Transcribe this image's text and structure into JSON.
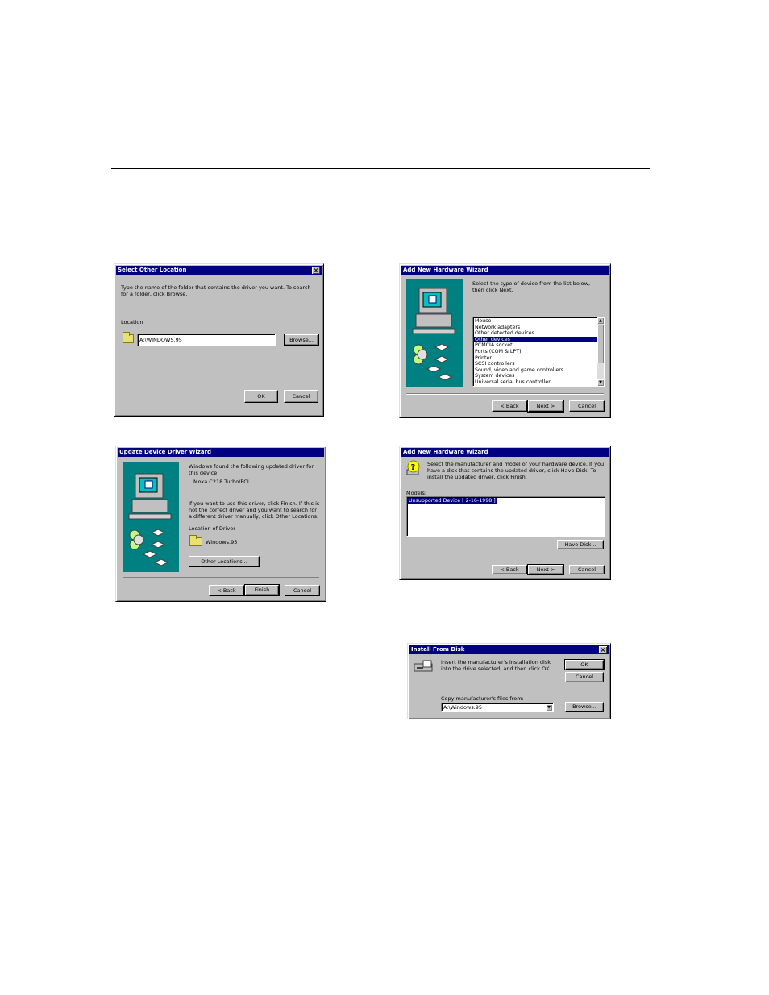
{
  "dialogs": {
    "select_location": {
      "title": "Select Other Location",
      "instruction": "Type the name of the folder that contains the driver you want. To search for a folder, click Browse.",
      "location_label": "Location",
      "location_value": "A:\\WINDOWS.95",
      "browse_label": "Browse...",
      "ok_label": "OK",
      "cancel_label": "Cancel"
    },
    "add_hw_1": {
      "title": "Add New Hardware Wizard",
      "instruction": "Select the type of device from the list below, then click Next.",
      "device_types": [
        "Mouse",
        "Network adapters",
        "Other detected devices",
        "Other devices",
        "PCMCIA socket",
        "Ports (COM & LPT)",
        "Printer",
        "SCSI controllers",
        "Sound, video and game controllers",
        "System devices",
        "Universal serial bus controller"
      ],
      "selected_index": 3,
      "back_label": "< Back",
      "next_label": "Next >",
      "cancel_label": "Cancel"
    },
    "update_driver": {
      "title": "Update Device Driver Wizard",
      "found_text": "Windows found the following updated driver for this device:",
      "device_name": "Moxa C218 Turbo/PCI",
      "hint_text": "If you want to use this driver, click Finish. If this is not the correct driver and you want to search for a different driver manually, click Other Locations.",
      "location_label": "Location of Driver",
      "location_value": "Windows.95",
      "other_locations_label": "Other Locations...",
      "back_label": "< Back",
      "finish_label": "Finish",
      "cancel_label": "Cancel"
    },
    "add_hw_2": {
      "title": "Add New Hardware Wizard",
      "instruction": "Select the manufacturer and model of your hardware device. If you have a disk that contains the updated driver, click Have Disk. To install the updated driver, click Finish.",
      "models_label": "Models:",
      "models": [
        "Unsupported Device [ 2-16-1998 ]"
      ],
      "have_disk_label": "Have Disk...",
      "back_label": "< Back",
      "next_label": "Next >",
      "cancel_label": "Cancel"
    },
    "install_disk": {
      "title": "Install From Disk",
      "instruction": "Insert the manufacturer's installation disk into the drive selected, and then click OK.",
      "ok_label": "OK",
      "cancel_label": "Cancel",
      "copy_label": "Copy manufacturer's files from:",
      "copy_value": "A:\\Windows.95",
      "browse_label": "Browse..."
    }
  },
  "colors": {
    "dialog_face": "#c0c0c0",
    "title_bar": "#000080",
    "wizard_panel": "#008080"
  }
}
